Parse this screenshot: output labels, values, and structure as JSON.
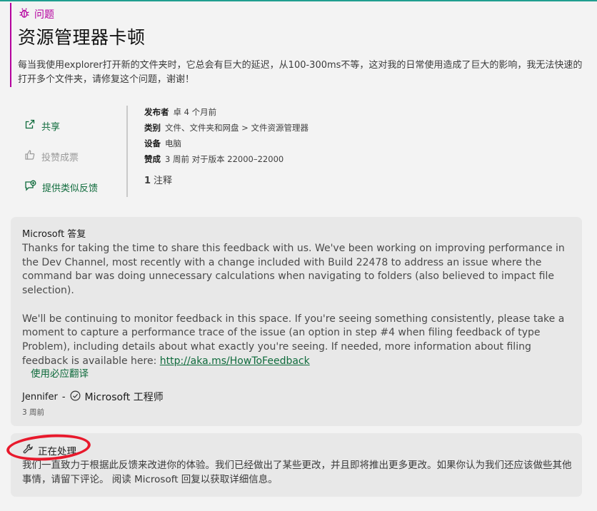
{
  "issue": {
    "type_label": "问题",
    "title": "资源管理器卡顿",
    "description": "每当我使用explorer打开新的文件夹时，它总会有巨大的延迟，从100-300ms不等，这对我的日常使用造成了巨大的影响，我无法快速的打开多个文件夹，请修复这个问题，谢谢！"
  },
  "actions": {
    "share": "共享",
    "upvote": "投赞成票",
    "similar_feedback": "提供类似反馈"
  },
  "meta": {
    "publisher_key": "发布者",
    "publisher_val": "卓 4 个月前",
    "category_key": "类别",
    "category_val": "文件、文件夹和网盘 > 文件资源管理器",
    "device_key": "设备",
    "device_val": "电脑",
    "upvotes_key": "赞成",
    "upvotes_val": "3 周前 对于版本 22000–22000",
    "comment_count": "1",
    "comment_label": "注释"
  },
  "response": {
    "title": "Microsoft 答复",
    "para1": "Thanks for taking the time to share this feedback with us. We've been working on improving performance in the Dev Channel, most recently with a change included with Build 22478 to address an issue where the command bar was doing unnecessary calculations when navigating to folders (also believed to impact file selection).",
    "para2_text": "We'll be continuing to monitor feedback in this space. If you're seeing something consistently, please take a moment to capture a performance trace of the issue (an option in step #4 when filing feedback of type Problem), including details about what exactly you're seeing. If needed, more information about filing feedback is available here: ",
    "para2_link": "http://aka.ms/HowToFeedback",
    "translate_label": "使用必应翻译",
    "author_name": "Jennifer",
    "author_sep": "-",
    "author_role": "Microsoft 工程师",
    "time": "3 周前"
  },
  "status": {
    "label": "正在处理",
    "description": "我们一直致力于根据此反馈来改进你的体验。我们已经做出了某些更改，并且即将推出更多更改。如果你认为我们还应该做些其他事情，请留下评论。 阅读 Microsoft 回复以获取详细信息。"
  },
  "colors": {
    "accent_green": "#0f6b3c",
    "issue_magenta": "#b4009e",
    "annotation_red": "#e8192c"
  },
  "icons": {
    "issue_type": "bug-icon",
    "share": "share-icon",
    "upvote": "thumbs-up-icon",
    "similar": "feedback-add-icon",
    "verified": "check-circle-icon",
    "status": "wrench-icon"
  }
}
